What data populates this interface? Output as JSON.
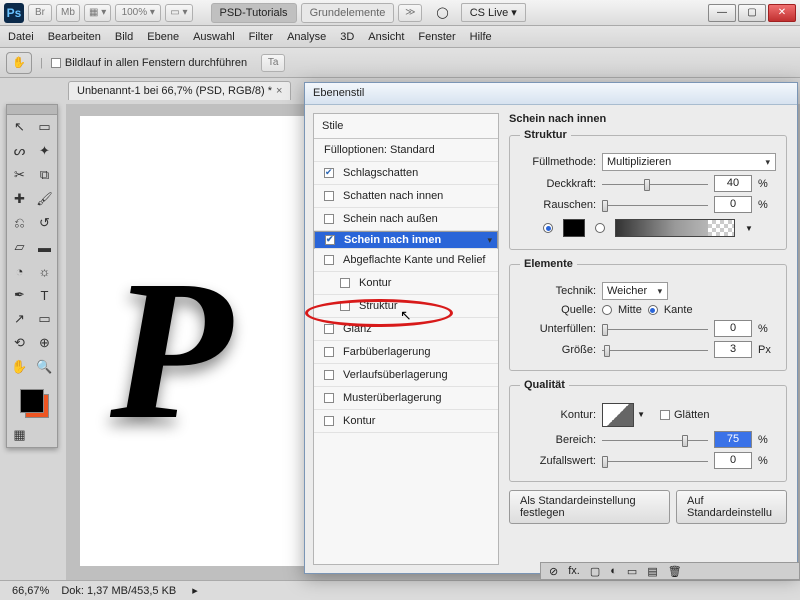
{
  "topbar": {
    "br": "Br",
    "mb": "Mb",
    "zoom_options": "▦ ▾",
    "zoom": "100% ▾",
    "screen": "▭ ▾",
    "tab_active": "PSD-Tutorials",
    "tab2": "Grundelemente",
    "more": "≫",
    "cs_live": "CS Live ▾",
    "min": "—",
    "max": "▢",
    "close": "✕"
  },
  "menu": [
    "Datei",
    "Bearbeiten",
    "Bild",
    "Ebene",
    "Auswahl",
    "Filter",
    "Analyse",
    "3D",
    "Ansicht",
    "Fenster",
    "Hilfe"
  ],
  "optbar": {
    "scroll_all": "Bildlauf in allen Fenstern durchführen",
    "btn": "Ta"
  },
  "doc": {
    "tab": "Unbenannt-1 bei 66,7% (PSD, RGB/8) *"
  },
  "status": {
    "zoom": "66,67%",
    "doc": "Dok: 1,37 MB/453,5 KB"
  },
  "canvas": {
    "glyph": "P"
  },
  "dialog": {
    "title": "Ebenenstil",
    "styles_hdr": "Stile",
    "fillopts": "Fülloptionen: Standard",
    "items": [
      {
        "label": "Schlagschatten",
        "checked": true
      },
      {
        "label": "Schatten nach innen",
        "checked": false
      },
      {
        "label": "Schein nach außen",
        "checked": false
      },
      {
        "label": "Schein nach innen",
        "checked": true,
        "selected": true
      },
      {
        "label": "Abgeflachte Kante und Relief",
        "checked": false
      },
      {
        "label": "Kontur",
        "checked": false,
        "indent": true
      },
      {
        "label": "Struktur",
        "checked": false,
        "indent": true
      },
      {
        "label": "Glanz",
        "checked": false
      },
      {
        "label": "Farbüberlagerung",
        "checked": false
      },
      {
        "label": "Verlaufsüberlagerung",
        "checked": false
      },
      {
        "label": "Musterüberlagerung",
        "checked": false
      },
      {
        "label": "Kontur",
        "checked": false
      }
    ],
    "right_title": "Schein nach innen",
    "struktur": "Struktur",
    "fill_method_lbl": "Füllmethode:",
    "fill_method": "Multiplizieren",
    "opacity_lbl": "Deckkraft:",
    "opacity": "40",
    "noise_lbl": "Rauschen:",
    "noise": "0",
    "pct": "%",
    "elemente": "Elemente",
    "technik_lbl": "Technik:",
    "technik": "Weicher",
    "quelle_lbl": "Quelle:",
    "mitte": "Mitte",
    "kante": "Kante",
    "unterf_lbl": "Unterfüllen:",
    "unterf": "0",
    "size_lbl": "Größe:",
    "size": "3",
    "px": "Px",
    "quality": "Qualität",
    "kontur_lbl": "Kontur:",
    "glatten": "Glätten",
    "bereich_lbl": "Bereich:",
    "bereich": "75",
    "zufall_lbl": "Zufallswert:",
    "zufall": "0",
    "btn_default": "Als Standardeinstellung festlegen",
    "btn_reset": "Auf Standardeinstellu"
  }
}
